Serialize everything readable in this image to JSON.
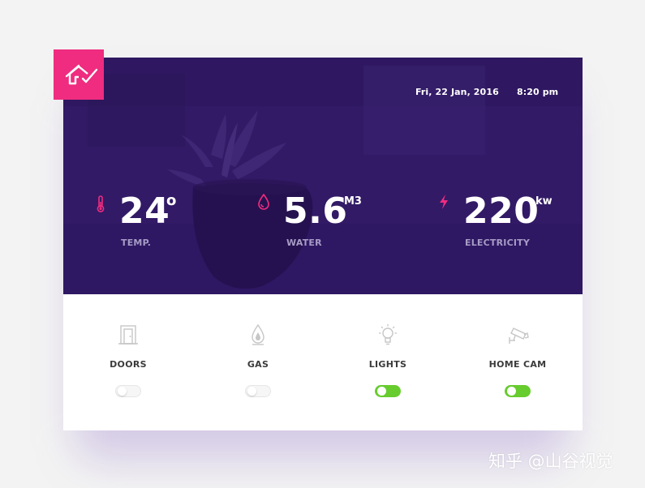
{
  "header": {
    "date": "Fri, 22 Jan, 2016",
    "time": "8:20 pm"
  },
  "stats": [
    {
      "icon": "thermometer-icon",
      "value": "24",
      "unit": "o",
      "label": "TEMP."
    },
    {
      "icon": "water-drop-icon",
      "value": "5.6",
      "unit": "M3",
      "label": "WATER"
    },
    {
      "icon": "lightning-icon",
      "value": "220",
      "unit": "kw",
      "label": "ELECTRICITY"
    }
  ],
  "controls": [
    {
      "icon": "door-icon",
      "label": "DOORS",
      "on": false
    },
    {
      "icon": "gas-flame-icon",
      "label": "GAS",
      "on": false
    },
    {
      "icon": "light-bulb-icon",
      "label": "LIGHTS",
      "on": true
    },
    {
      "icon": "security-camera-icon",
      "label": "HOME CAM",
      "on": true
    }
  ],
  "colors": {
    "hero": "#321a66",
    "accent": "#ef2c7f",
    "toggle_on": "#67cc2e",
    "toggle_off": "#f6f6f6",
    "label_muted": "#a79cc6"
  },
  "logo": {
    "icon": "home-check-icon"
  },
  "watermark": "知乎 @山谷视觉"
}
